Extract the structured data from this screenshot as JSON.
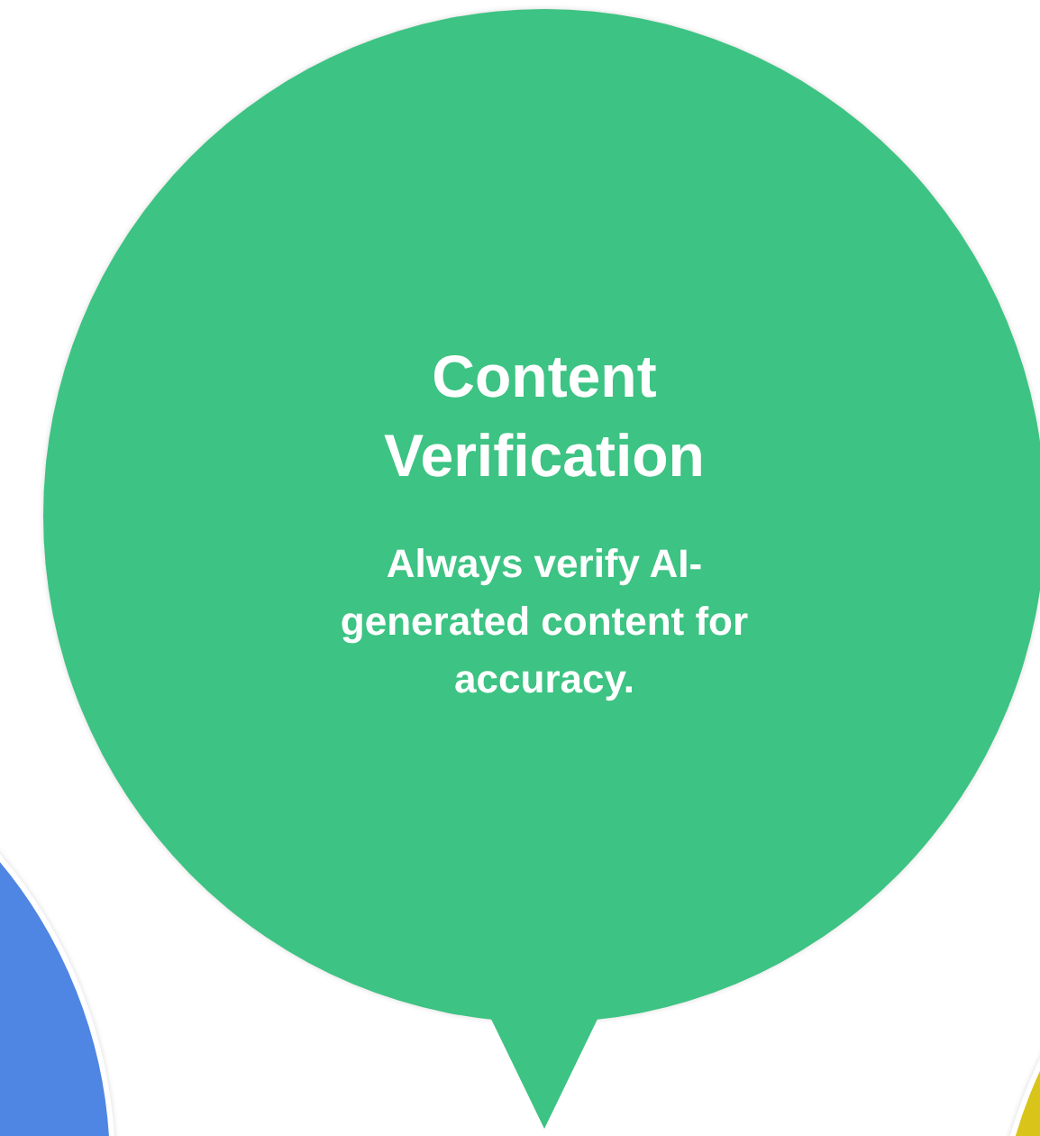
{
  "card": {
    "title": "Content Verification",
    "body": "Always verify AI-generated content for accuracy."
  }
}
